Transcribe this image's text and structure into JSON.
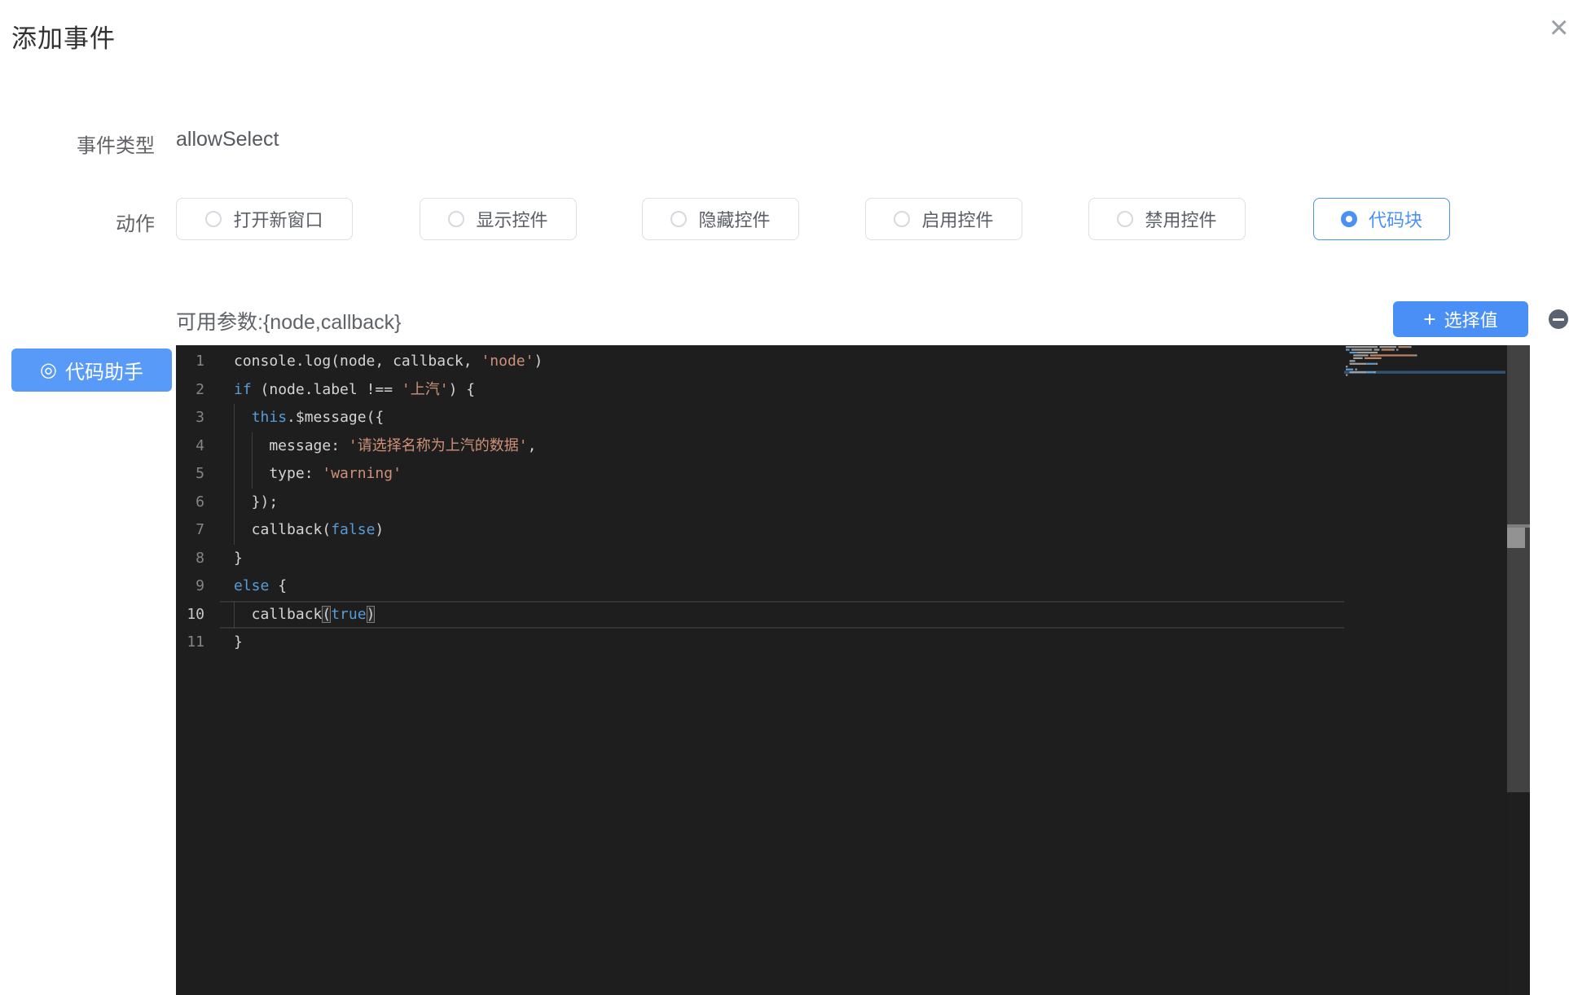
{
  "colors": {
    "accent": "#4a90f5",
    "select_value_bg": "#4a8ff6",
    "assistant_bg": "#579af8",
    "editor_bg": "#1e1e1e",
    "keyword": "#569cd6",
    "string": "#ce9178",
    "code_text": "#d4d4d4"
  },
  "dialog": {
    "title": "添加事件",
    "close_icon": "×"
  },
  "form": {
    "event_type_label": "事件类型",
    "event_type_value": "allowSelect",
    "action_label": "动作",
    "actions": [
      {
        "label": "打开新窗口",
        "selected": false
      },
      {
        "label": "显示控件",
        "selected": false
      },
      {
        "label": "隐藏控件",
        "selected": false
      },
      {
        "label": "启用控件",
        "selected": false
      },
      {
        "label": "禁用控件",
        "selected": false
      },
      {
        "label": "代码块",
        "selected": true
      }
    ]
  },
  "code_panel": {
    "params_text": "可用参数:{node,callback}",
    "select_value_label": "选择值",
    "select_value_plus": "+",
    "assistant_label": "代码助手",
    "assistant_icon": "◎",
    "editor": {
      "active_line": 10,
      "lines": [
        {
          "n": 1,
          "t": [
            [
              "t",
              "console.log(node, callback, "
            ],
            [
              "s",
              "'node'"
            ],
            [
              "t",
              ")"
            ]
          ]
        },
        {
          "n": 2,
          "t": [
            [
              "k",
              "if"
            ],
            [
              "t",
              " (node.label !== "
            ],
            [
              "s",
              "'上汽'"
            ],
            [
              "t",
              ") {"
            ]
          ]
        },
        {
          "n": 3,
          "t": [
            [
              "t",
              "  "
            ],
            [
              "k",
              "this"
            ],
            [
              "t",
              ".$message({"
            ]
          ]
        },
        {
          "n": 4,
          "t": [
            [
              "t",
              "    message: "
            ],
            [
              "s",
              "'请选择名称为上汽的数据'"
            ],
            [
              "t",
              ","
            ]
          ]
        },
        {
          "n": 5,
          "t": [
            [
              "t",
              "    type: "
            ],
            [
              "s",
              "'warning'"
            ]
          ]
        },
        {
          "n": 6,
          "t": [
            [
              "t",
              "  });"
            ]
          ]
        },
        {
          "n": 7,
          "t": [
            [
              "t",
              "  callback("
            ],
            [
              "k",
              "false"
            ],
            [
              "t",
              ")"
            ]
          ]
        },
        {
          "n": 8,
          "t": [
            [
              "t",
              "}"
            ]
          ]
        },
        {
          "n": 9,
          "t": [
            [
              "k",
              "else"
            ],
            [
              "t",
              " {"
            ]
          ]
        },
        {
          "n": 10,
          "t": [
            [
              "t",
              "  callback"
            ],
            [
              "b",
              "("
            ],
            [
              "k",
              "true"
            ],
            [
              "b",
              ")"
            ]
          ]
        },
        {
          "n": 11,
          "t": [
            [
              "t",
              "}"
            ]
          ]
        }
      ]
    }
  }
}
